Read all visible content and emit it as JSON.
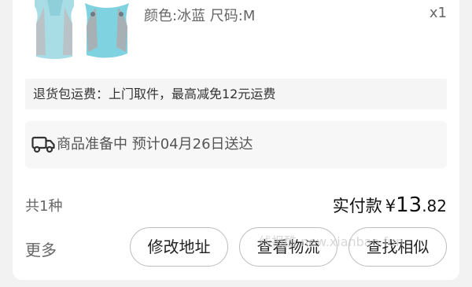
{
  "item": {
    "spec": "颜色:冰蓝 尺码:M",
    "quantity": "x1"
  },
  "return_shipping": {
    "text": "退货包运费：上门取件，最高减免12元运费"
  },
  "shipping_status": {
    "icon": "truck-icon",
    "text": "商品准备中 预计04月26日送达"
  },
  "summary": {
    "count": "共1种",
    "paid_label": "实付款",
    "currency": "¥",
    "amount_int": "13",
    "amount_dec": ".82"
  },
  "actions": {
    "more": "更多",
    "modify_address": "修改地址",
    "view_logistics": "查看物流",
    "find_similar": "查找相似"
  },
  "watermark": "线报酷 new.xianbao.fun"
}
